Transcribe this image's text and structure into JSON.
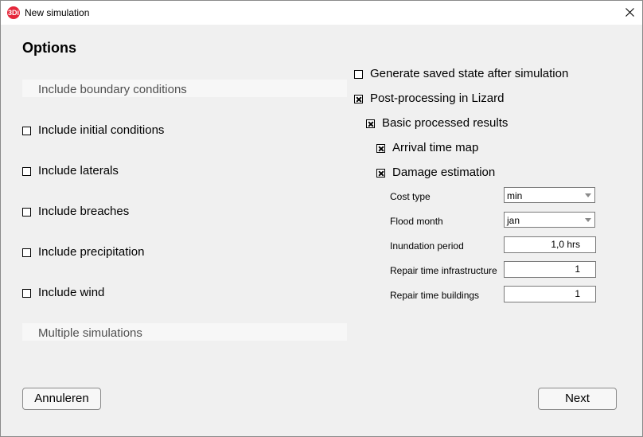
{
  "window": {
    "title": "New simulation",
    "app_icon": "3Di"
  },
  "page": {
    "heading": "Options"
  },
  "left": {
    "sections": {
      "boundary": "Include boundary conditions",
      "multiple": "Multiple simulations"
    },
    "checkboxes": [
      {
        "label": "Include initial conditions",
        "checked": false
      },
      {
        "label": "Include laterals",
        "checked": false
      },
      {
        "label": "Include breaches",
        "checked": false
      },
      {
        "label": "Include precipitation",
        "checked": false
      },
      {
        "label": "Include wind",
        "checked": false
      }
    ]
  },
  "right": {
    "checkboxes": [
      {
        "label": "Generate saved state after simulation",
        "checked": false
      },
      {
        "label": "Post-processing in Lizard",
        "checked": true
      },
      {
        "label": "Basic processed results",
        "checked": true
      },
      {
        "label": "Arrival time map",
        "checked": true
      },
      {
        "label": "Damage estimation",
        "checked": true
      }
    ],
    "fields": {
      "cost_type": {
        "label": "Cost type",
        "value": "min"
      },
      "flood_month": {
        "label": "Flood month",
        "value": "jan"
      },
      "inundation_period": {
        "label": "Inundation period",
        "value": "1,0 hrs"
      },
      "repair_infrastructure": {
        "label": "Repair time infrastructure",
        "value": "1"
      },
      "repair_buildings": {
        "label": "Repair time buildings",
        "value": "1"
      }
    }
  },
  "buttons": {
    "cancel": "Annuleren",
    "next": "Next"
  }
}
